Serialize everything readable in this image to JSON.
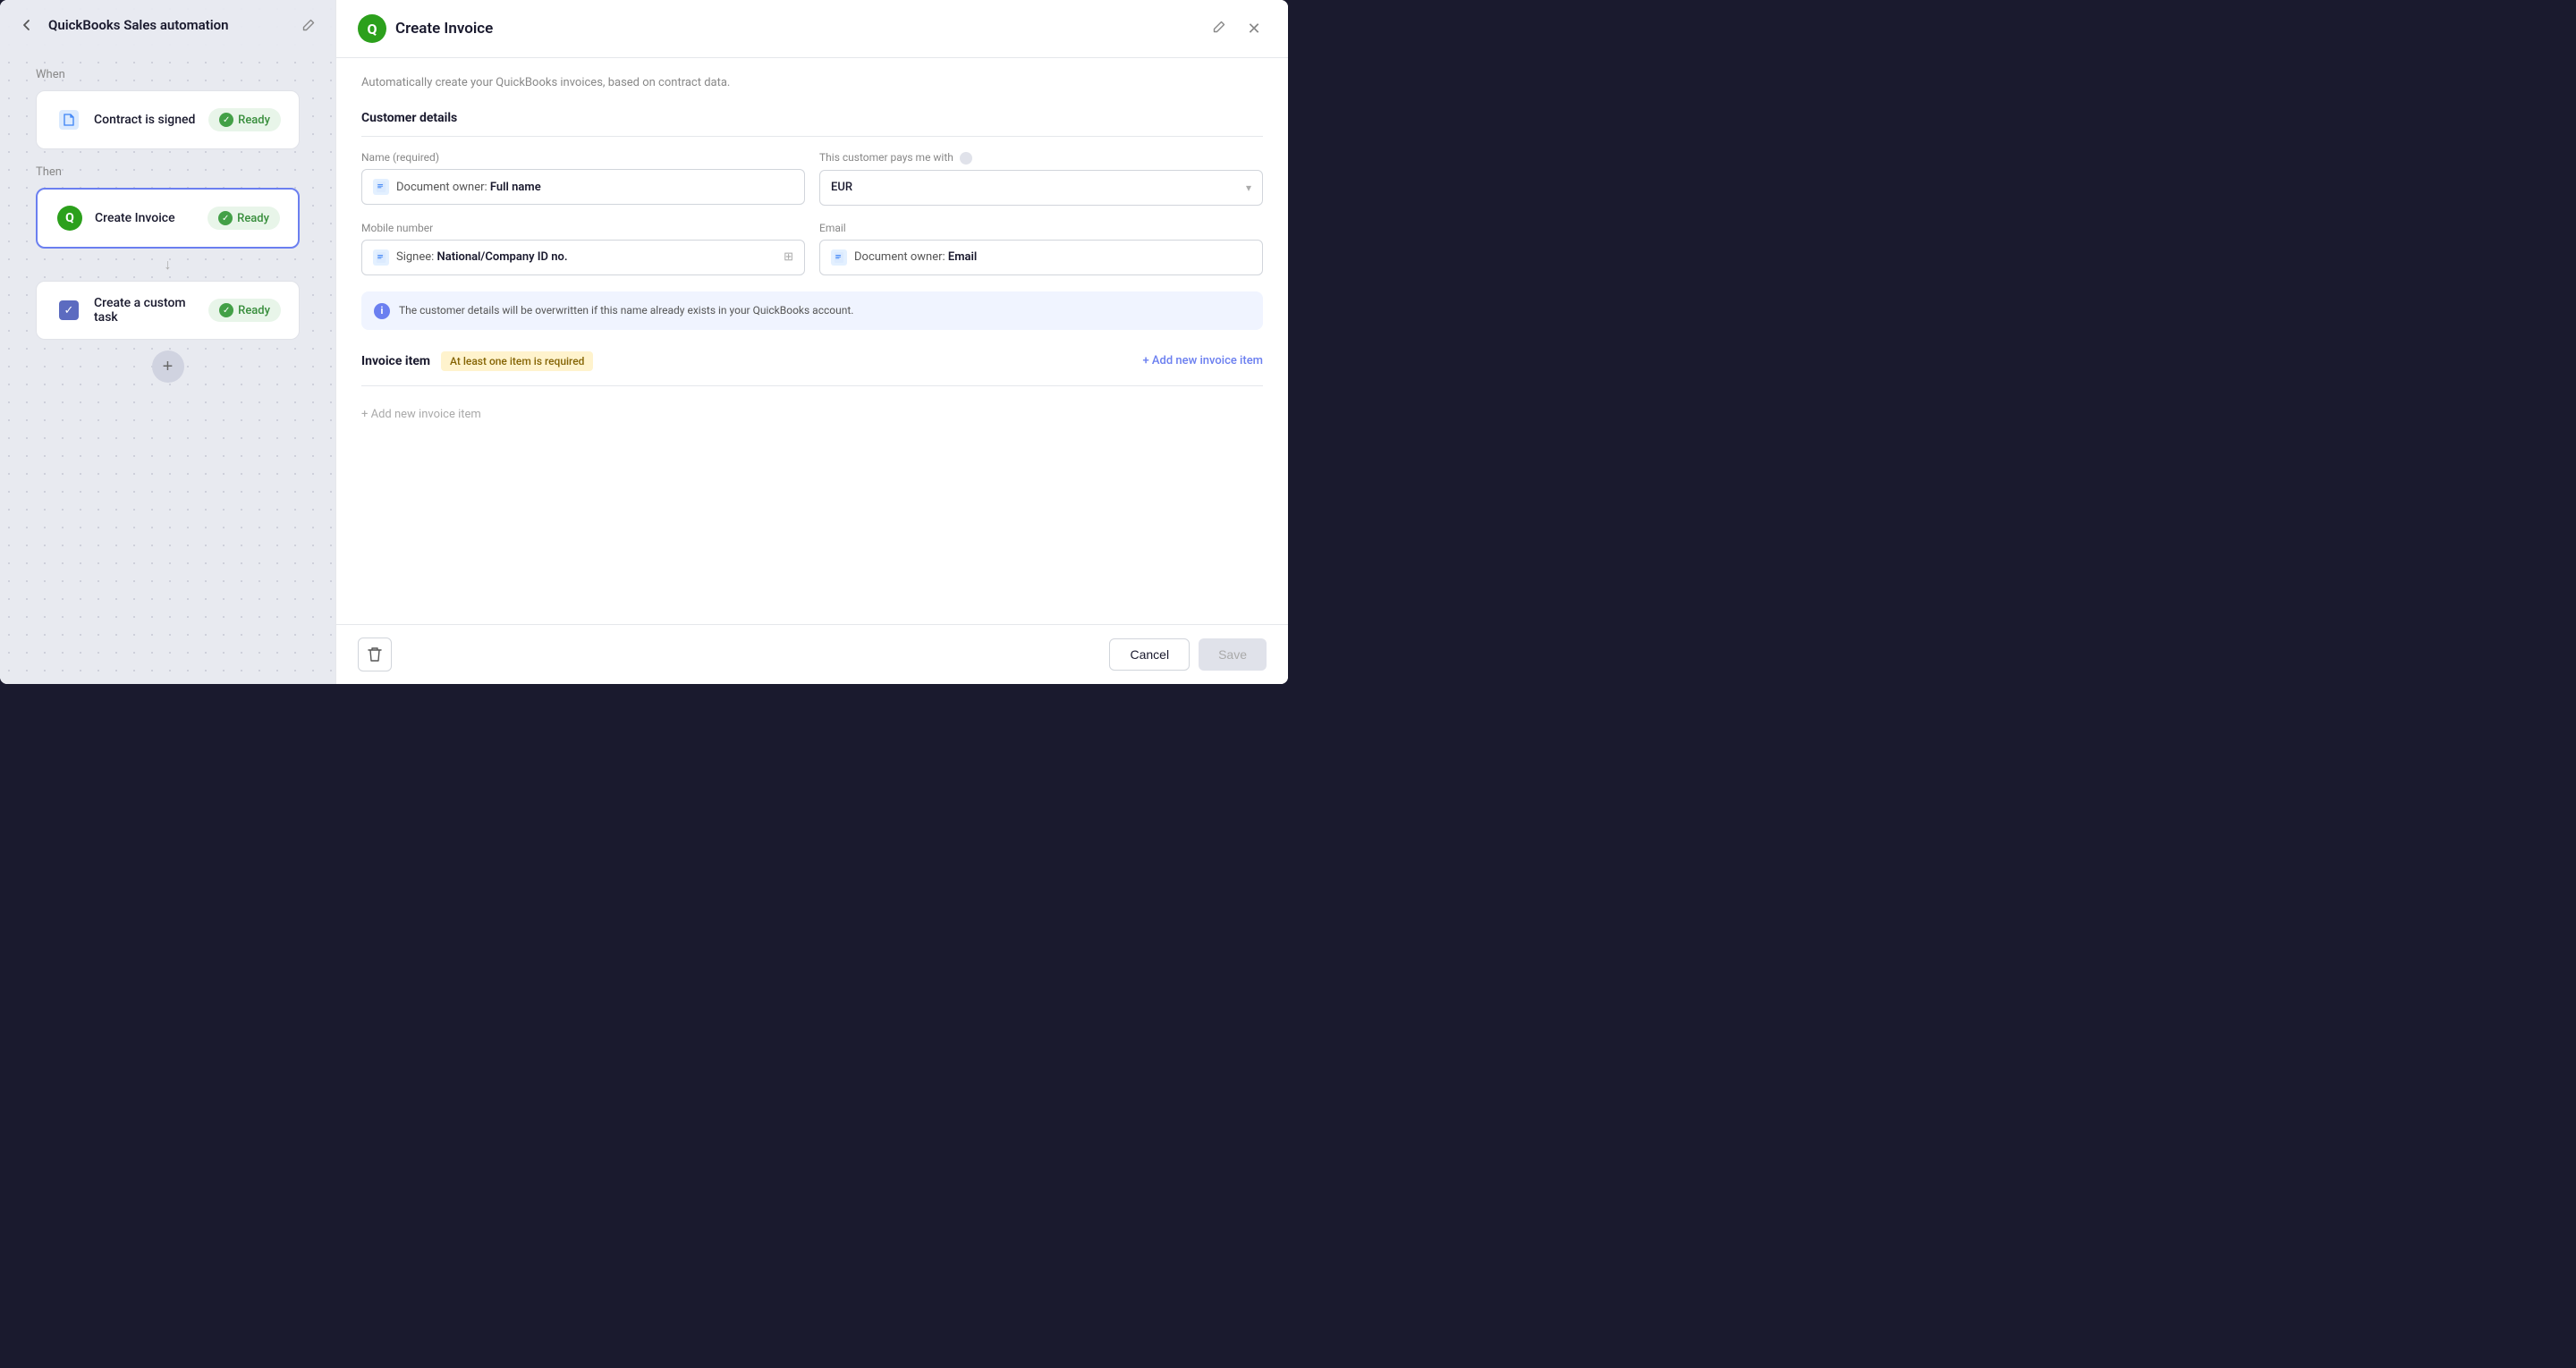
{
  "app": {
    "title": "QuickBooks Sales automation"
  },
  "left_panel": {
    "back_label": "←",
    "edit_icon": "✏",
    "when_label": "When",
    "then_label": "Then",
    "step1": {
      "name": "Contract is signed",
      "ready_label": "Ready"
    },
    "step2": {
      "name": "Create Invoice",
      "ready_label": "Ready"
    },
    "step3": {
      "name": "Create a custom task",
      "ready_label": "Ready"
    },
    "add_step_label": "+"
  },
  "right_panel": {
    "title": "Create Invoice",
    "subtitle": "Automatically create your QuickBooks invoices, based on contract data.",
    "edit_icon": "✏",
    "close_icon": "✕",
    "customer_details_title": "Customer details",
    "name_label": "Name (required)",
    "name_value": "Document owner:",
    "name_value_bold": "Full name",
    "currency_label": "This customer pays me with",
    "currency_value": "EUR",
    "mobile_label": "Mobile number",
    "mobile_value": "Signee:",
    "mobile_value_bold": "National/Company ID no.",
    "email_label": "Email",
    "email_value": "Document owner:",
    "email_value_bold": "Email",
    "info_text": "The customer details will be overwritten if this name already exists in your QuickBooks account.",
    "invoice_item_title": "Invoice item",
    "warning_text": "At least one item is required",
    "add_item_label": "+ Add new invoice item",
    "add_item_bottom_label": "+ Add new invoice item",
    "cancel_label": "Cancel",
    "save_label": "Save"
  }
}
